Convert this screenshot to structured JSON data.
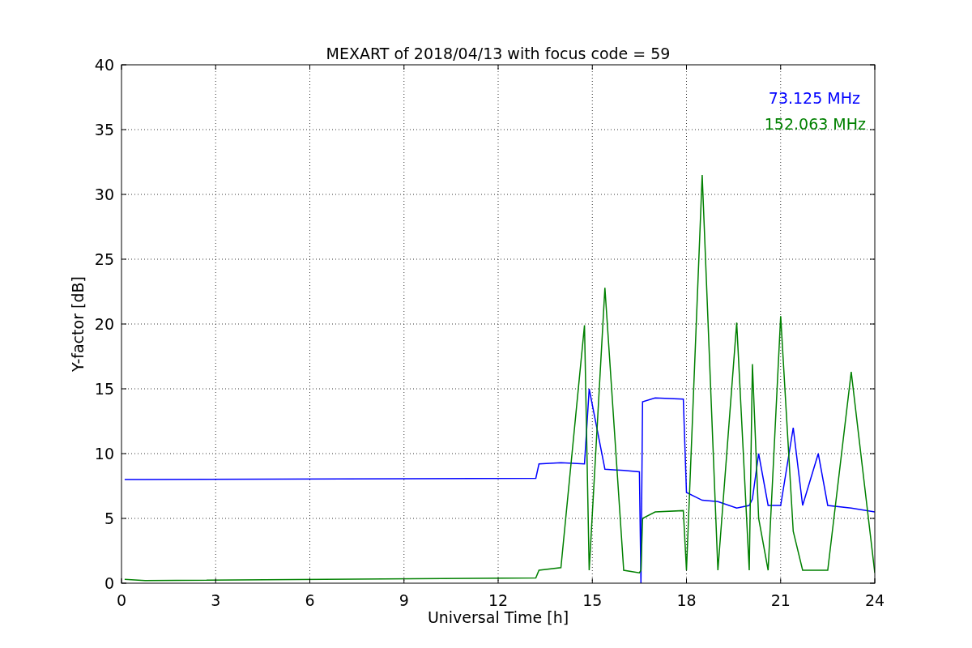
{
  "figure": {
    "chart_data": {
      "type": "line",
      "title": "MEXART of 2018/04/13 with focus code = 59",
      "xlabel": "Universal Time [h]",
      "ylabel": "Y-factor [dB]",
      "x": [
        0.1,
        0.75,
        13.2,
        13.3,
        14,
        14.75,
        14.9,
        15.4,
        16,
        16.5,
        16.55,
        16.6,
        17,
        17.9,
        18,
        18.5,
        19,
        19.6,
        20,
        20.1,
        20.3,
        20.6,
        21,
        21.4,
        21.7,
        22.2,
        22.5,
        23.25,
        24
      ],
      "series": [
        {
          "name": "73.125 MHz",
          "color": "#0000ff",
          "values": [
            8,
            8,
            8.1,
            9.2,
            9.3,
            9.2,
            15,
            8.8,
            8.7,
            8.6,
            0,
            14,
            14.3,
            14.2,
            7,
            6.4,
            6.3,
            5.8,
            6,
            6.5,
            10,
            6,
            6,
            12,
            6,
            10,
            6,
            5.8,
            5.5
          ]
        },
        {
          "name": "152.063 MHz",
          "color": "#008000",
          "values": [
            0.3,
            0.2,
            0.4,
            1,
            1.2,
            19.9,
            1,
            22.8,
            1,
            0.8,
            1,
            5,
            5.5,
            5.6,
            1,
            31.5,
            1,
            20.1,
            1,
            16.9,
            5,
            1,
            20.6,
            4,
            1,
            1,
            1,
            16.3,
            0.8
          ]
        }
      ],
      "xlim": [
        0,
        24
      ],
      "ylim": [
        0,
        40
      ],
      "xticks": [
        0,
        3,
        6,
        9,
        12,
        15,
        18,
        21,
        24
      ],
      "yticks": [
        0,
        5,
        10,
        15,
        20,
        25,
        30,
        35,
        40
      ],
      "grid": true
    }
  }
}
